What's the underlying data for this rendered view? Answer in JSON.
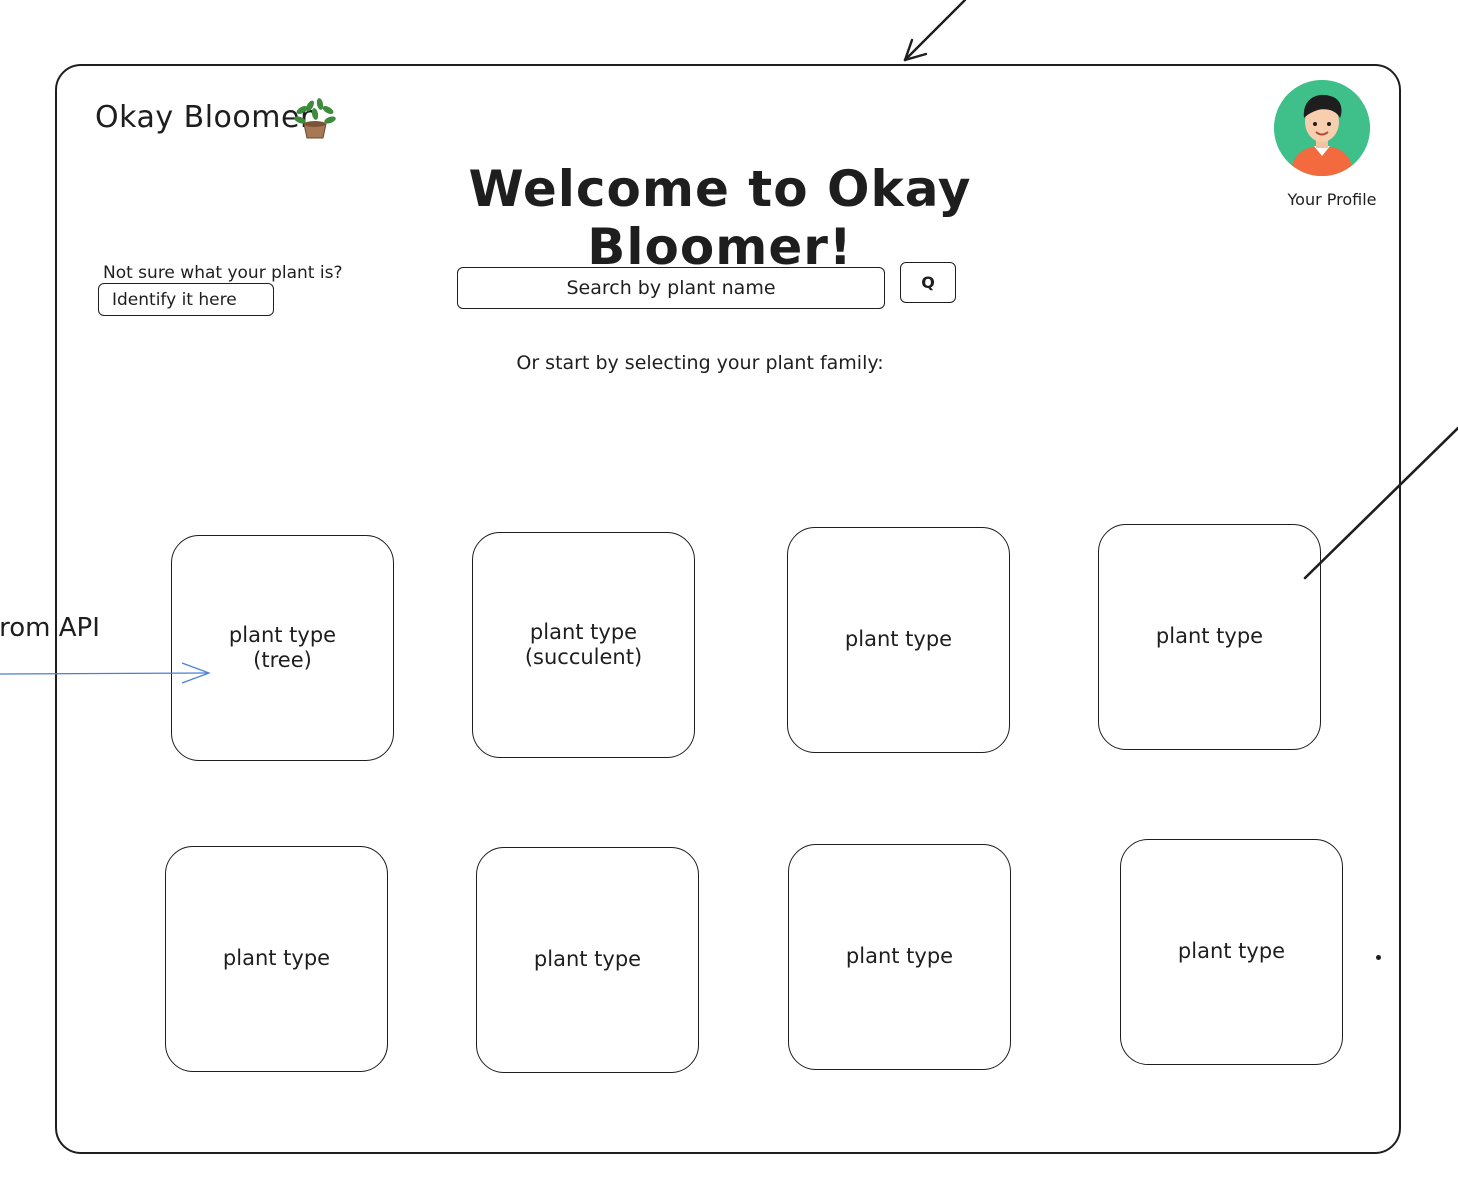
{
  "app": {
    "logo_text": "Okay Bloomer",
    "welcome_title": "Welcome to Okay Bloomer!"
  },
  "profile": {
    "label": "Your Profile"
  },
  "identify": {
    "prompt": "Not sure what your plant is?",
    "button_label": "Identify it here"
  },
  "search": {
    "placeholder": "Search by plant name",
    "button_label": "Q"
  },
  "family_prompt": "Or start by selecting your plant family:",
  "cards": [
    {
      "label": "plant type\n(tree)"
    },
    {
      "label": "plant type\n(succulent)"
    },
    {
      "label": "plant type"
    },
    {
      "label": "plant type"
    },
    {
      "label": "plant type"
    },
    {
      "label": "plant type"
    },
    {
      "label": "plant type"
    },
    {
      "label": "plant type"
    }
  ],
  "annotation": {
    "api_label": "from API"
  },
  "colors": {
    "ink": "#1e1e1e",
    "annotation_arrow": "#4a7fd4",
    "avatar_bg": "#3fbf8a"
  }
}
